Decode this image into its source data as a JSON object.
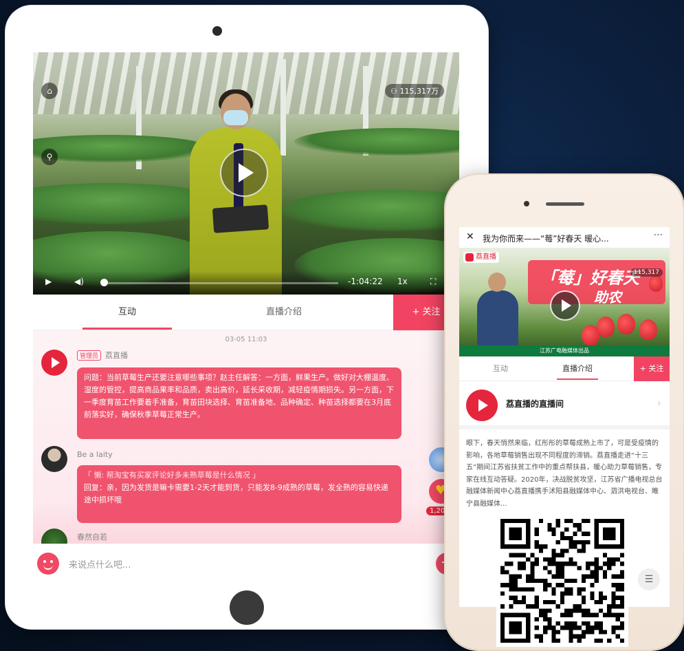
{
  "tablet": {
    "video": {
      "viewers": "115,317万",
      "time_remaining": "-1:04:22",
      "speed": "1x"
    },
    "tabs": [
      {
        "label": "互动",
        "active": true
      },
      {
        "label": "直播介绍",
        "active": false
      }
    ],
    "follow_label": "+ 关注",
    "chat": {
      "timestamp": "03-05 11:03",
      "messages": [
        {
          "badge": "管理员",
          "user": "荔直播",
          "text": "问题：当前草莓生产还要注意哪些事项？赵主任解答：一方面，鲜果生产。做好对大棚温度、湿度的管控，提高商品果率和品质，卖出高价，延长采收期，减轻疫情期损失。另一方面，下一季度育苗工作要着手准备，育苗田块选择、育苗准备地、品种确定、种苗选择都要在3月底前落实好，确保秋季草莓正常生产。"
        },
        {
          "user": "Be a laity",
          "quote": "「 懒: 帮淘宝有买家评论好多未熟草莓是什么情况 」",
          "text": "回复：亲，因为发货是嘛卡需要1-2天才能到货，只能发8-9成熟的草莓，发全熟的容易快递途中损坏哦"
        },
        {
          "user": "春然自若"
        }
      ],
      "like_count": "1,20..."
    },
    "input_placeholder": "来说点什么吧..."
  },
  "phone": {
    "title": "我为你而来——“莓”好春天 暖心...",
    "more": "···",
    "brand": "荔直播",
    "banner_line1": "「莓」好春天",
    "banner_line2": "助农",
    "viewers": "115,317",
    "banner_footer": "江苏广电融媒体出品",
    "tabs": [
      {
        "label": "互动",
        "active": false
      },
      {
        "label": "直播介绍",
        "active": true
      }
    ],
    "follow_label": "+ 关注",
    "host_name": "荔直播的直播间",
    "intro": "眼下，春天悄然来临，红彤彤的草莓成熟上市了，可是受疫情的影响，各地草莓销售出现不同程度的滞销。荔直播走进“十三五”期间江苏省扶贫工作中的重点帮扶县，暖心助力草莓销售，专家在线互动答疑。2020年，决战脱贫攻坚，江苏省广播电视总台融媒体新闻中心荔直播携手沭阳县融媒体中心、泗洪电视台、睢宁县融媒体..."
  },
  "colors": {
    "accent": "#f04865",
    "brand_red": "#e5253c",
    "background": "#0a1a33"
  }
}
